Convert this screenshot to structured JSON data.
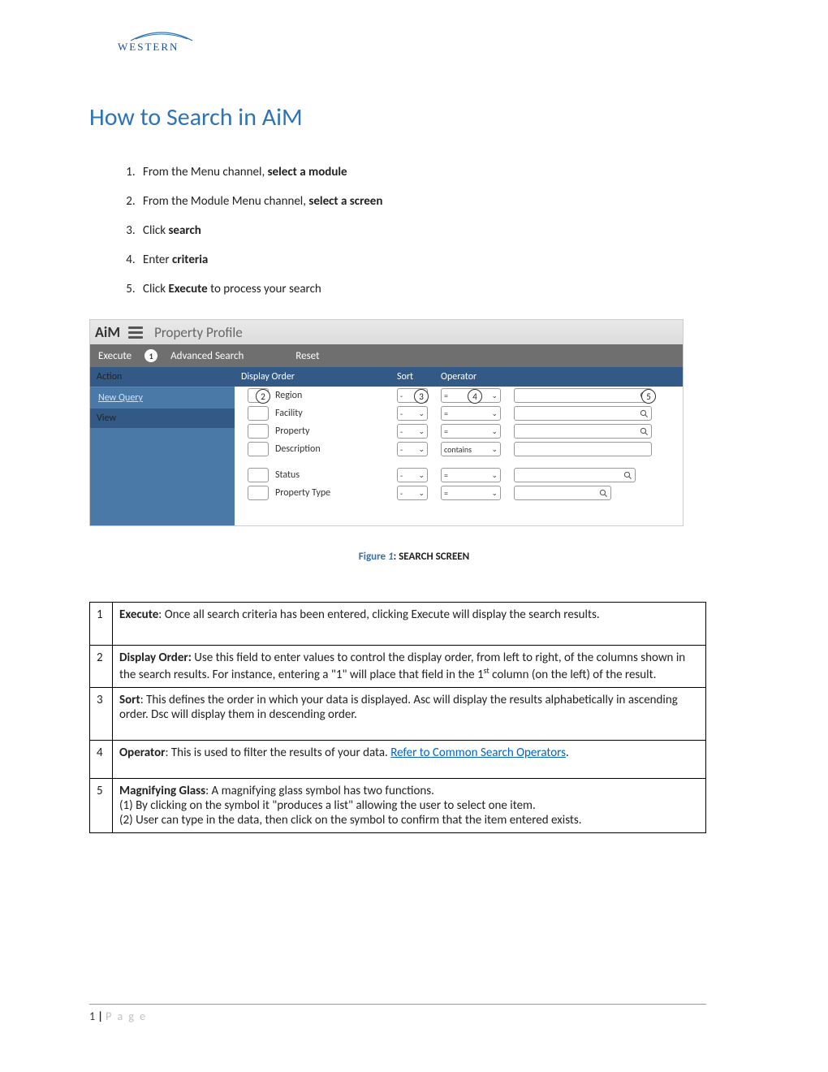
{
  "logo_text": "WESTERN",
  "title": "How to Search in AiM",
  "steps": [
    {
      "pre": "From the Menu channel, ",
      "bold": "select a module",
      "post": ""
    },
    {
      "pre": "From the Module Menu channel, ",
      "bold": "select a screen",
      "post": ""
    },
    {
      "pre": "Click ",
      "bold": "search",
      "post": ""
    },
    {
      "pre": "Enter ",
      "bold": "criteria",
      "post": ""
    },
    {
      "pre": "Click ",
      "bold": "Execute",
      "post": " to process your search"
    }
  ],
  "screenshot": {
    "app_name": "AiM",
    "screen_title": "Property Profile",
    "toolbar": {
      "execute": "Execute",
      "badge": "1",
      "advanced": "Advanced Search",
      "reset": "Reset"
    },
    "left": {
      "action_hdr": "Action",
      "new_query": "New Query",
      "view": "View"
    },
    "headers": {
      "display_order": "Display Order",
      "sort": "Sort",
      "operator": "Operator"
    },
    "rows1": [
      {
        "label": "Region",
        "sort": "-",
        "op": "="
      },
      {
        "label": "Facility",
        "sort": "-",
        "op": "="
      },
      {
        "label": "Property",
        "sort": "-",
        "op": "="
      },
      {
        "label": "Description",
        "sort": "-",
        "op": "contains"
      }
    ],
    "rows2": [
      {
        "label": "Status",
        "sort": "-",
        "op": "="
      },
      {
        "label": "Property Type",
        "sort": "-",
        "op": "="
      }
    ],
    "callouts": {
      "c1": "1",
      "c2": "2",
      "c3": "3",
      "c4": "4",
      "c5": "5"
    }
  },
  "figure": {
    "label": "Figure ",
    "num": "1",
    "colon_title": ": SEARCH SCREEN"
  },
  "table": [
    {
      "n": "1",
      "bold": "Execute",
      "rest": ": Once all search criteria has been entered, clicking Execute will display the search results.",
      "extra_pad": true
    },
    {
      "n": "2",
      "bold": "Display Order:",
      "rest": " Use this field to enter values to control the display order, from left to right, of the columns shown in the search results. For instance, entering a \"1\" will place that field in the 1",
      "sup": "st",
      "rest2": " column (on the left) of the result."
    },
    {
      "n": "3",
      "bold": "Sort",
      "rest": ": This defines the order in which your data is displayed. Asc will display the results alphabetically in ascending order. Dsc will display them in descending order.",
      "extra_pad_small": true
    },
    {
      "n": "4",
      "bold": "Operator",
      "rest": ": This is used to filter the results of your data. ",
      "link": "Refer to Common Search Operators",
      "rest2": ".",
      "extra_pad_small": true
    },
    {
      "n": "5",
      "bold": "Magnifying Glass",
      "rest": ": A magnifying glass symbol has two functions.",
      "line2": "(1) By clicking on the symbol it \"produces a list\" allowing the user to select one item.",
      "line3": "(2) User can type in the data, then click on the symbol to confirm that the item entered exists."
    }
  ],
  "footer": {
    "num": "1",
    "page": "P a g e"
  }
}
